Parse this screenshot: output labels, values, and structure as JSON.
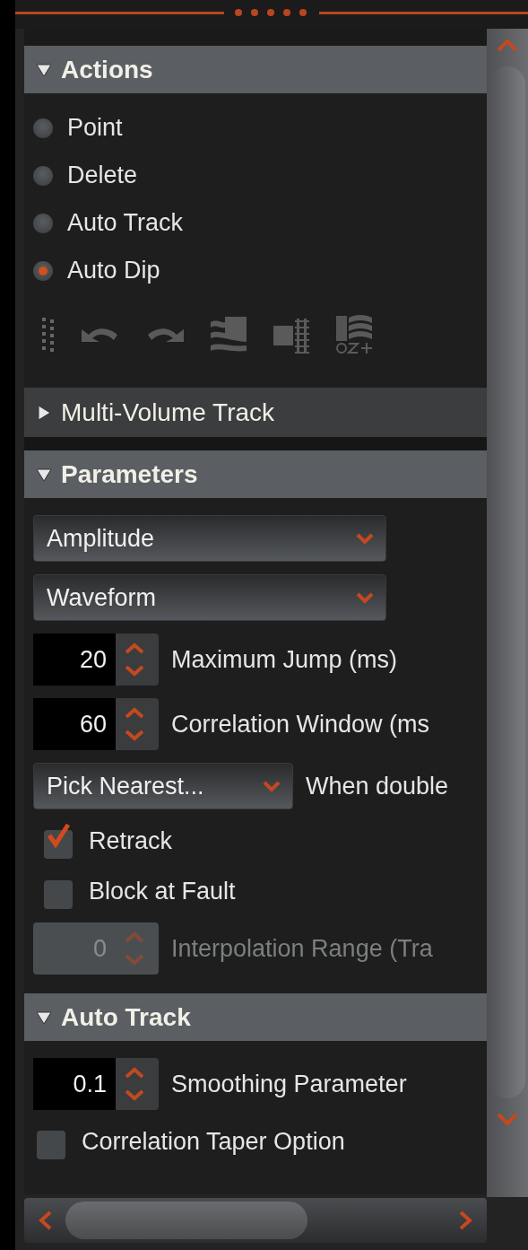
{
  "sections": [
    {
      "title": "Actions",
      "expanded": true,
      "radios": [
        {
          "label": "Point",
          "selected": false
        },
        {
          "label": "Delete",
          "selected": false
        },
        {
          "label": "Auto Track",
          "selected": false
        },
        {
          "label": "Auto Dip",
          "selected": true
        }
      ]
    },
    {
      "title": "Multi-Volume Track",
      "expanded": false
    },
    {
      "title": "Parameters",
      "expanded": true,
      "controls": [
        {
          "kind": "dropdown",
          "value": "Amplitude"
        },
        {
          "kind": "dropdown",
          "value": "Waveform"
        },
        {
          "kind": "spinner",
          "value": "20",
          "label": "Maximum Jump (ms)",
          "disabled": false
        },
        {
          "kind": "spinner",
          "value": "60",
          "label": "Correlation Window (ms",
          "disabled": false
        },
        {
          "kind": "dropdown",
          "value": "Pick Nearest...",
          "caption": "When double"
        },
        {
          "kind": "checkbox",
          "label": "Retrack",
          "checked": true
        },
        {
          "kind": "checkbox",
          "label": "Block at Fault",
          "checked": false
        },
        {
          "kind": "spinner",
          "value": "0",
          "label": "Interpolation Range (Tra",
          "disabled": true
        }
      ]
    },
    {
      "title": "Auto Track",
      "expanded": true,
      "controls": [
        {
          "kind": "spinner",
          "value": "0.1",
          "label": "Smoothing Parameter",
          "disabled": false
        },
        {
          "kind": "checkbox",
          "label": "Correlation Taper Option",
          "checked": false
        }
      ]
    }
  ]
}
